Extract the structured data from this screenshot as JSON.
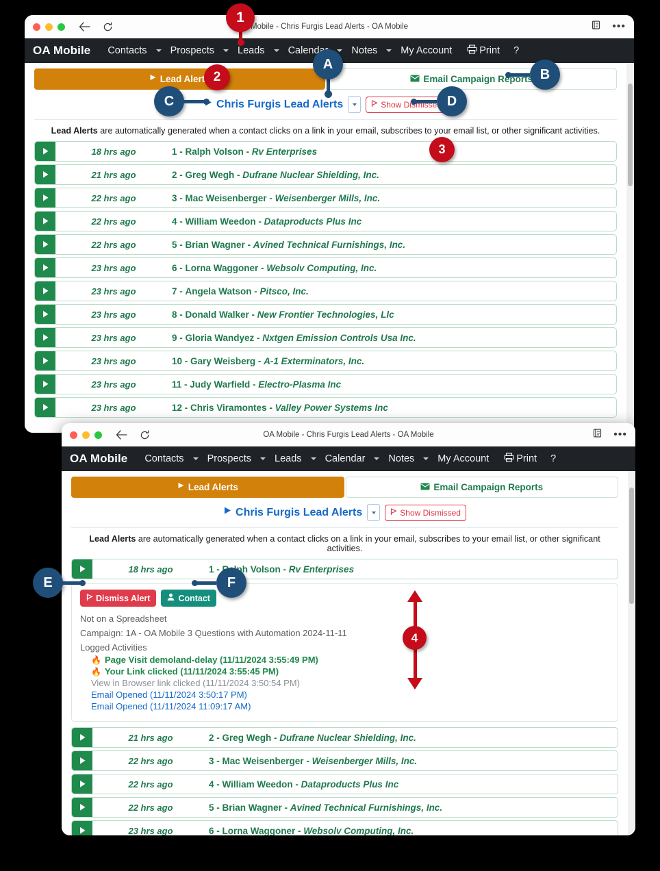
{
  "window_top": {
    "title": "Mobile - Chris Furgis Lead Alerts - OA Mobile",
    "icons": {
      "back": "back-arrow-icon",
      "reload": "reload-icon",
      "reader": "reader-view-icon",
      "more": "more-options-icon"
    }
  },
  "window_bottom": {
    "title": "OA Mobile - Chris Furgis Lead Alerts - OA Mobile"
  },
  "nav": {
    "brand": "OA Mobile",
    "items": [
      {
        "label": "Contacts",
        "caret": true
      },
      {
        "label": "Prospects",
        "caret": true
      },
      {
        "label": "Leads",
        "caret": true
      },
      {
        "label": "Calendar",
        "caret": true
      },
      {
        "label": "Notes",
        "caret": true
      },
      {
        "label": "My Account",
        "caret": false
      },
      {
        "label": "Print",
        "caret": false,
        "icon": "printer-icon"
      },
      {
        "label": "?",
        "caret": false
      }
    ]
  },
  "tabs": {
    "lead_alerts": "Lead Alerts",
    "email_campaign_reports": "Email Campaign Reports"
  },
  "subbar": {
    "title": "Chris Furgis Lead Alerts",
    "show_dismissed": "Show Dismissed"
  },
  "explain": {
    "bold": "Lead Alerts",
    "rest": " are automatically generated when a contact clicks on a link in your email, subscribes to your email list, or other significant activities."
  },
  "alerts": [
    {
      "time": "18 hrs ago",
      "num": "1",
      "name": "Ralph Volson",
      "company": "Rv Enterprises"
    },
    {
      "time": "21 hrs ago",
      "num": "2",
      "name": "Greg Wegh",
      "company": "Dufrane Nuclear Shielding, Inc."
    },
    {
      "time": "22 hrs ago",
      "num": "3",
      "name": "Mac Weisenberger",
      "company": "Weisenberger Mills, Inc."
    },
    {
      "time": "22 hrs ago",
      "num": "4",
      "name": "William Weedon",
      "company": "Dataproducts Plus Inc"
    },
    {
      "time": "22 hrs ago",
      "num": "5",
      "name": "Brian Wagner",
      "company": "Avined Technical Furnishings, Inc."
    },
    {
      "time": "23 hrs ago",
      "num": "6",
      "name": "Lorna Waggoner",
      "company": "Websolv Computing, Inc."
    },
    {
      "time": "23 hrs ago",
      "num": "7",
      "name": "Angela Watson",
      "company": "Pitsco, Inc."
    },
    {
      "time": "23 hrs ago",
      "num": "8",
      "name": "Donald Walker",
      "company": "New Frontier Technologies, Llc"
    },
    {
      "time": "23 hrs ago",
      "num": "9",
      "name": "Gloria Wandyez",
      "company": "Nxtgen Emission Controls Usa Inc."
    },
    {
      "time": "23 hrs ago",
      "num": "10",
      "name": "Gary Weisberg",
      "company": "A-1 Exterminators, Inc."
    },
    {
      "time": "23 hrs ago",
      "num": "11",
      "name": "Judy Warfield",
      "company": "Electro-Plasma Inc"
    },
    {
      "time": "23 hrs ago",
      "num": "12",
      "name": "Chris Viramontes",
      "company": "Valley Power Systems Inc"
    }
  ],
  "detail": {
    "dismiss_label": "Dismiss Alert",
    "contact_label": "Contact",
    "spreadsheet": "Not on a Spreadsheet",
    "campaign": "Campaign: 1A - OA Mobile 3 Questions with Automation 2024-11-11",
    "logged_heading": "Logged Activities",
    "activities": [
      {
        "text": "Page Visit demoland-delay (11/11/2024 3:55:49 PM)",
        "style": "green",
        "icon": "flame-icon"
      },
      {
        "text": "Your Link clicked (11/11/2024 3:55:45 PM)",
        "style": "green",
        "icon": "flame-icon"
      },
      {
        "text": "View in Browser link clicked (11/11/2024 3:50:54 PM)",
        "style": "grey",
        "icon": ""
      },
      {
        "text": "Email Opened (11/11/2024 3:50:17 PM)",
        "style": "blue",
        "icon": ""
      },
      {
        "text": "Email Opened (11/11/2024 11:09:17 AM)",
        "style": "blue",
        "icon": ""
      }
    ]
  },
  "callouts": [
    {
      "id": "1",
      "kind": "red"
    },
    {
      "id": "2",
      "kind": "red"
    },
    {
      "id": "3",
      "kind": "red"
    },
    {
      "id": "4",
      "kind": "red"
    },
    {
      "id": "A",
      "kind": "blue"
    },
    {
      "id": "B",
      "kind": "blue"
    },
    {
      "id": "C",
      "kind": "blue"
    },
    {
      "id": "D",
      "kind": "blue"
    },
    {
      "id": "E",
      "kind": "blue"
    },
    {
      "id": "F",
      "kind": "blue"
    }
  ],
  "colors": {
    "accent_orange": "#d2820a",
    "green": "#1f8a4c",
    "blue_link": "#1669c8",
    "red": "#dc3545",
    "teal": "#148f7e",
    "callout_red": "#c40c1b",
    "callout_blue": "#1f4e79",
    "navbar": "#1f2328"
  }
}
